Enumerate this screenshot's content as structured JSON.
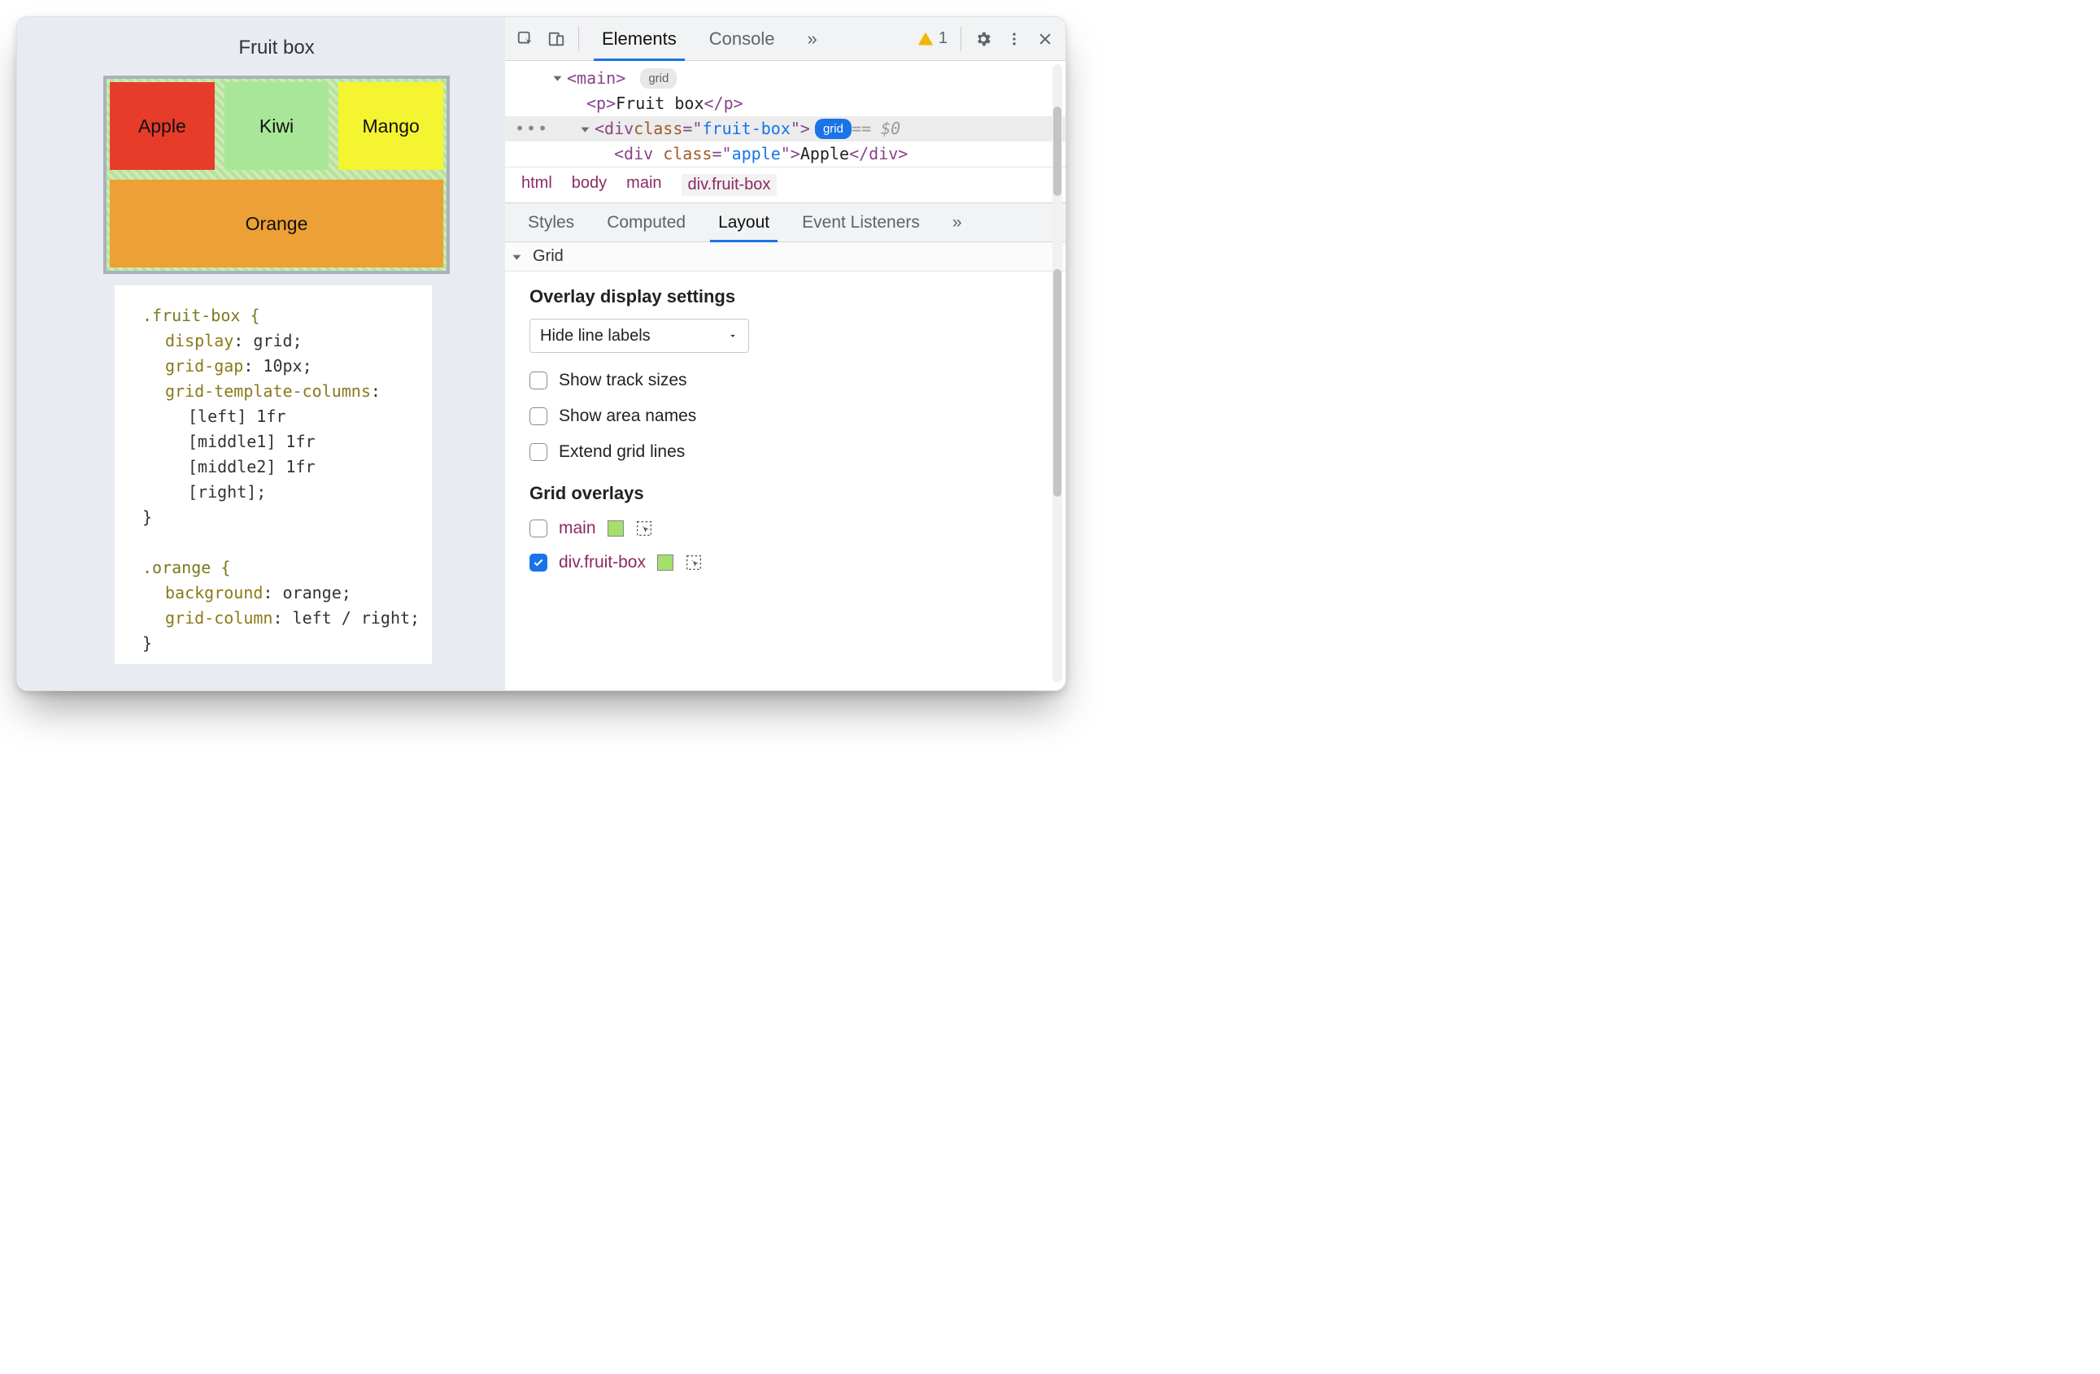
{
  "page": {
    "title": "Fruit box",
    "cells": {
      "apple": "Apple",
      "kiwi": "Kiwi",
      "mango": "Mango",
      "orange": "Orange"
    },
    "css": {
      "rule1_selector": ".fruit-box {",
      "rule1_l1": "display",
      "rule1_v1": ": grid;",
      "rule1_l2": "grid-gap",
      "rule1_v2": ": 10px;",
      "rule1_l3": "grid-template-columns",
      "rule1_v3": ":",
      "rule1_c1": "[left] 1fr",
      "rule1_c2": "[middle1] 1fr",
      "rule1_c3": "[middle2] 1fr",
      "rule1_c4": "[right];",
      "brace_close": "}",
      "rule2_selector": ".orange {",
      "rule2_l1": "background",
      "rule2_v1": ": orange;",
      "rule2_l2": "grid-column",
      "rule2_v2": ": left / right;"
    }
  },
  "devtools": {
    "tabs": {
      "elements": "Elements",
      "console": "Console",
      "more": "»"
    },
    "warn_count": "1",
    "dom": {
      "main_open": "<main>",
      "main_badge": "grid",
      "p_line": "<p>Fruit box</p>",
      "div_open_pre": "<div ",
      "div_attr": "class",
      "div_eq": "=\"",
      "div_val": "fruit-box",
      "div_open_post": "\">",
      "div_badge": "grid",
      "eq0": " == $0",
      "apple_pre": "<div ",
      "apple_attr": "class",
      "apple_val": "apple",
      "apple_txt": "Apple",
      "apple_close": "</div>"
    },
    "breadcrumb": [
      "html",
      "body",
      "main",
      "div.fruit-box"
    ],
    "subtabs": {
      "styles": "Styles",
      "computed": "Computed",
      "layout": "Layout",
      "events": "Event Listeners",
      "more": "»"
    },
    "layout": {
      "section": "Grid",
      "overlay_title": "Overlay display settings",
      "select_label": "Hide line labels",
      "opt_tracks": "Show track sizes",
      "opt_areas": "Show area names",
      "opt_extend": "Extend grid lines",
      "overlays_title": "Grid overlays",
      "overlays": [
        {
          "name": "main",
          "checked": false
        },
        {
          "name": "div.fruit-box",
          "checked": true
        }
      ]
    }
  }
}
